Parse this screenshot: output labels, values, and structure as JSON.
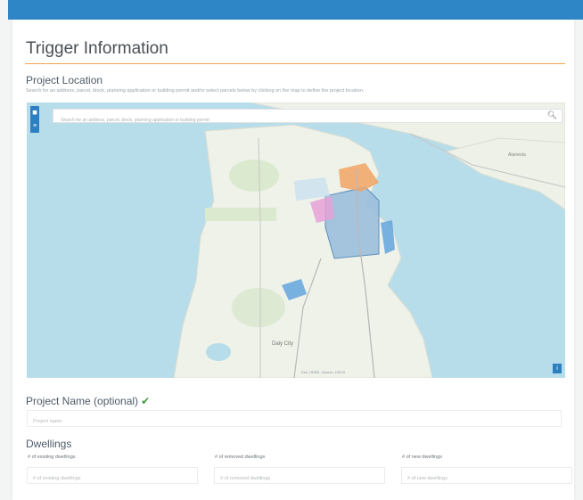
{
  "header": {
    "title": "Trigger Information"
  },
  "project_location": {
    "heading": "Project Location",
    "help_text": "Search for an address, parcel, block, planning application or building permit and/or select parcels below by clicking on the map to define the project location.",
    "search": {
      "placeholder": "Search for an address, parcel, block, planning application or building permit",
      "value": ""
    },
    "map": {
      "attribution": "Esri, HERE, Garmin, USGS"
    },
    "colors": {
      "water": "#b8ddea",
      "land": "#eef2e9",
      "accent": "#2c7fc0"
    }
  },
  "project_name": {
    "label": "Project Name (optional)",
    "check_icon": "✔",
    "placeholder": "Project name",
    "value": ""
  },
  "dwellings": {
    "heading": "Dwellings",
    "fields": [
      {
        "label": "# of existing dwellings",
        "placeholder": "# of existing dwellings",
        "value": ""
      },
      {
        "label": "# of removed dwellings",
        "placeholder": "# of removed dwellings",
        "value": ""
      },
      {
        "label": "# of new dwellings",
        "placeholder": "# of new dwellings",
        "value": ""
      }
    ]
  }
}
